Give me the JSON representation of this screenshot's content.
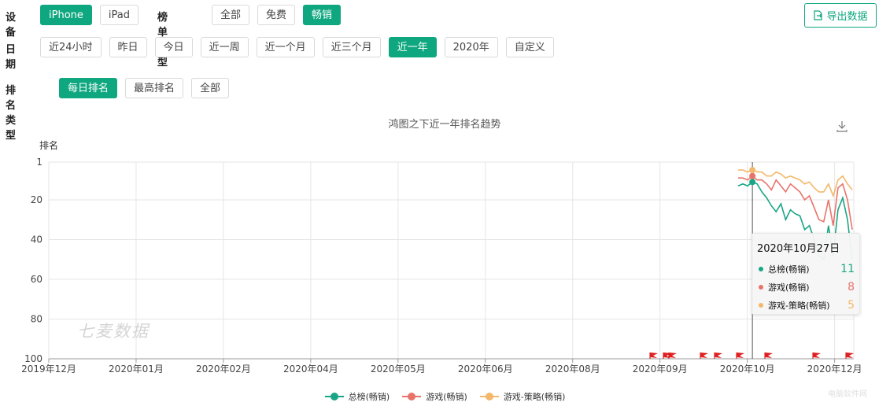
{
  "filters": {
    "device": {
      "label": "设备",
      "options": [
        "iPhone",
        "iPad"
      ],
      "selected": 0
    },
    "chart_type": {
      "label": "榜单类型",
      "options": [
        "全部",
        "免费",
        "畅销"
      ],
      "selected": 2
    },
    "date": {
      "label": "日期",
      "options": [
        "近24小时",
        "昨日",
        "今日",
        "近一周",
        "近一个月",
        "近三个月",
        "近一年",
        "2020年",
        "自定义"
      ],
      "selected": 6
    },
    "rank_type": {
      "label": "排名类型",
      "options": [
        "每日排名",
        "最高排名",
        "全部"
      ],
      "selected": 0
    }
  },
  "export_label": "导出数据",
  "watermark": "七麦数据",
  "corner_mark": "电脑软件网",
  "chart_data": {
    "type": "line",
    "title": "鸿图之下近一年排名趋势",
    "ylabel": "排名",
    "y_inverted": true,
    "ylim": [
      1,
      100
    ],
    "yticks": [
      1,
      20,
      40,
      60,
      80,
      100
    ],
    "xticks": [
      "2019年12月",
      "2020年01月",
      "2020年02月",
      "2020年04月",
      "2020年05月",
      "2020年06月",
      "2020年08月",
      "2020年09月",
      "2020年10月",
      "2020年12月"
    ],
    "x": [
      "2020年10月24日",
      "2020年10月25日",
      "2020年10月26日",
      "2020年10月27日",
      "2020年10月28日",
      "2020年10月30日",
      "2020年11月01日",
      "2020年11月03日",
      "2020年11月05日",
      "2020年11月07日",
      "2020年11月09日",
      "2020年11月11日",
      "2020年11月13日",
      "2020年11月15日",
      "2020年11月17日",
      "2020年11月19日",
      "2020年11月21日",
      "2020年11月23日",
      "2020年11月25日",
      "2020年11月27日",
      "2020年11月29日",
      "2020年12月01日",
      "2020年12月03日",
      "2020年12月05日",
      "2020年12月07日"
    ],
    "series": [
      {
        "name": "总榜(畅销)",
        "color": "#1aa685",
        "values": [
          13,
          12,
          13,
          11,
          12,
          16,
          19,
          23,
          26,
          22,
          30,
          25,
          27,
          28,
          35,
          33,
          40,
          48,
          50,
          33,
          48,
          25,
          19,
          30,
          50
        ]
      },
      {
        "name": "游戏(畅销)",
        "color": "#e8736b",
        "values": [
          9,
          9,
          10,
          8,
          10,
          10,
          12,
          15,
          10,
          13,
          16,
          12,
          14,
          16,
          20,
          18,
          24,
          30,
          31,
          20,
          33,
          14,
          12,
          20,
          35
        ]
      },
      {
        "name": "游戏-策略(畅销)",
        "color": "#f3b86b",
        "values": [
          5,
          5,
          6,
          5,
          6,
          6,
          8,
          8,
          6,
          7,
          9,
          8,
          9,
          10,
          12,
          11,
          14,
          16,
          16,
          12,
          18,
          10,
          8,
          12,
          15
        ]
      }
    ],
    "tooltip": {
      "date": "2020年10月27日",
      "items": [
        {
          "name": "总榜(畅销)",
          "value": "11"
        },
        {
          "name": "游戏(畅销)",
          "value": "8"
        },
        {
          "name": "游戏-策略(畅销)",
          "value": "5"
        }
      ]
    },
    "event_flags": [
      "2020年09月",
      "2020年09月",
      "2020年09月",
      "2020年09月",
      "2020年09月",
      "2020年10月",
      "2020年10月",
      "2020年11月",
      "2020年11月",
      "2020年12月"
    ],
    "grid": true,
    "legend_position": "bottom"
  }
}
